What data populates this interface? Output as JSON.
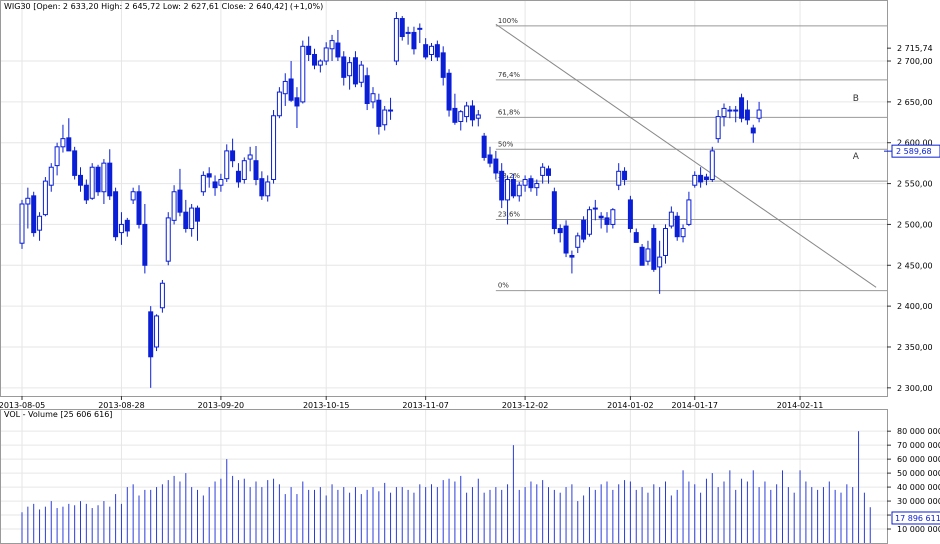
{
  "colors": {
    "accent": "#0a1fd6",
    "volume": "#2a3cd8",
    "grid": "#e6e6e6",
    "axis": "#333333",
    "trendline": "#888888",
    "fib": "#999999"
  },
  "price_legend": {
    "symbol": "WIG30",
    "text": "[Open: 2 633,20  High: 2 645,72  Low: 2 627,61  Close: 2 640,42] (+1,0%)"
  },
  "volume_legend": {
    "title": "VOL - Volume",
    "value": "[25 606 616]"
  },
  "chart_data": [
    {
      "type": "candlestick",
      "name": "WIG30",
      "ylim": [
        2290,
        2760
      ],
      "grid": true,
      "y_ticks": [
        2300,
        2350,
        2400,
        2450,
        2500,
        2550,
        2600,
        2650,
        2700
      ],
      "y_tick_labels": [
        "2 300,00",
        "2 350,00",
        "2 400,00",
        "2 450,00",
        "2 500,00",
        "2 550,00",
        "2 600,00",
        "2 650,00",
        "2 700,00"
      ],
      "x_labels": [
        {
          "i": 0,
          "label": "2013-08-05"
        },
        {
          "i": 17,
          "label": "2013-08-28"
        },
        {
          "i": 34,
          "label": "2013-09-20"
        },
        {
          "i": 52,
          "label": "2013-10-15"
        },
        {
          "i": 69,
          "label": "2013-11-07"
        },
        {
          "i": 86,
          "label": "2013-12-02"
        },
        {
          "i": 104,
          "label": "2014-01-02"
        },
        {
          "i": 115,
          "label": "2014-01-17"
        },
        {
          "i": 133,
          "label": "2014-02-11"
        }
      ],
      "last_value_marker": {
        "value": 2589.68,
        "label": "2 589,68"
      },
      "resistance_marker": {
        "value": 2715.74,
        "label": "2 715,74"
      },
      "fibonacci": {
        "levels": [
          {
            "label": "100%",
            "value": 2743
          },
          {
            "label": "76,4%",
            "value": 2677
          },
          {
            "label": "61,8%",
            "value": 2631
          },
          {
            "label": "50%",
            "value": 2592
          },
          {
            "label": "38,2%",
            "value": 2553
          },
          {
            "label": "23,6%",
            "value": 2506
          },
          {
            "label": "0%",
            "value": 2419
          }
        ],
        "start_i": 81
      },
      "trendline": {
        "from": {
          "i": 81,
          "value": 2745
        },
        "to": {
          "i": 146,
          "value": 2423
        }
      },
      "annotations": [
        {
          "text": "B",
          "i": 142,
          "value": 2655
        },
        {
          "text": "A",
          "i": 142,
          "value": 2584
        }
      ],
      "candles": [
        {
          "o": 2477,
          "h": 2530,
          "l": 2470,
          "c": 2525
        },
        {
          "o": 2525,
          "h": 2545,
          "l": 2495,
          "c": 2532
        },
        {
          "o": 2535,
          "h": 2540,
          "l": 2485,
          "c": 2490
        },
        {
          "o": 2493,
          "h": 2515,
          "l": 2480,
          "c": 2510
        },
        {
          "o": 2512,
          "h": 2558,
          "l": 2510,
          "c": 2553
        },
        {
          "o": 2548,
          "h": 2575,
          "l": 2540,
          "c": 2570
        },
        {
          "o": 2572,
          "h": 2600,
          "l": 2560,
          "c": 2595
        },
        {
          "o": 2595,
          "h": 2622,
          "l": 2588,
          "c": 2605
        },
        {
          "o": 2606,
          "h": 2630,
          "l": 2590,
          "c": 2590
        },
        {
          "o": 2590,
          "h": 2595,
          "l": 2555,
          "c": 2560
        },
        {
          "o": 2560,
          "h": 2570,
          "l": 2540,
          "c": 2548
        },
        {
          "o": 2548,
          "h": 2555,
          "l": 2525,
          "c": 2530
        },
        {
          "o": 2532,
          "h": 2575,
          "l": 2530,
          "c": 2570
        },
        {
          "o": 2570,
          "h": 2573,
          "l": 2535,
          "c": 2540
        },
        {
          "o": 2540,
          "h": 2580,
          "l": 2525,
          "c": 2575
        },
        {
          "o": 2575,
          "h": 2592,
          "l": 2530,
          "c": 2535
        },
        {
          "o": 2540,
          "h": 2545,
          "l": 2480,
          "c": 2485
        },
        {
          "o": 2490,
          "h": 2515,
          "l": 2475,
          "c": 2500
        },
        {
          "o": 2505,
          "h": 2508,
          "l": 2485,
          "c": 2492
        },
        {
          "o": 2530,
          "h": 2545,
          "l": 2525,
          "c": 2540
        },
        {
          "o": 2540,
          "h": 2548,
          "l": 2495,
          "c": 2500
        },
        {
          "o": 2500,
          "h": 2525,
          "l": 2440,
          "c": 2450
        },
        {
          "o": 2393,
          "h": 2400,
          "l": 2300,
          "c": 2338
        },
        {
          "o": 2350,
          "h": 2390,
          "l": 2345,
          "c": 2388
        },
        {
          "o": 2398,
          "h": 2432,
          "l": 2392,
          "c": 2428
        },
        {
          "o": 2455,
          "h": 2515,
          "l": 2450,
          "c": 2508
        },
        {
          "o": 2505,
          "h": 2548,
          "l": 2500,
          "c": 2540
        },
        {
          "o": 2542,
          "h": 2568,
          "l": 2510,
          "c": 2515
        },
        {
          "o": 2515,
          "h": 2530,
          "l": 2490,
          "c": 2495
        },
        {
          "o": 2495,
          "h": 2525,
          "l": 2485,
          "c": 2520
        },
        {
          "o": 2520,
          "h": 2523,
          "l": 2480,
          "c": 2504
        },
        {
          "o": 2540,
          "h": 2565,
          "l": 2535,
          "c": 2560
        },
        {
          "o": 2562,
          "h": 2570,
          "l": 2545,
          "c": 2558
        },
        {
          "o": 2552,
          "h": 2560,
          "l": 2535,
          "c": 2545
        },
        {
          "o": 2548,
          "h": 2562,
          "l": 2540,
          "c": 2555
        },
        {
          "o": 2556,
          "h": 2598,
          "l": 2552,
          "c": 2590
        },
        {
          "o": 2590,
          "h": 2605,
          "l": 2570,
          "c": 2578
        },
        {
          "o": 2565,
          "h": 2575,
          "l": 2545,
          "c": 2552
        },
        {
          "o": 2555,
          "h": 2582,
          "l": 2550,
          "c": 2578
        },
        {
          "o": 2580,
          "h": 2595,
          "l": 2565,
          "c": 2585
        },
        {
          "o": 2578,
          "h": 2596,
          "l": 2548,
          "c": 2555
        },
        {
          "o": 2556,
          "h": 2565,
          "l": 2530,
          "c": 2535
        },
        {
          "o": 2535,
          "h": 2560,
          "l": 2528,
          "c": 2552
        },
        {
          "o": 2555,
          "h": 2640,
          "l": 2550,
          "c": 2633
        },
        {
          "o": 2633,
          "h": 2668,
          "l": 2630,
          "c": 2662
        },
        {
          "o": 2660,
          "h": 2685,
          "l": 2645,
          "c": 2675
        },
        {
          "o": 2678,
          "h": 2700,
          "l": 2650,
          "c": 2652
        },
        {
          "o": 2655,
          "h": 2668,
          "l": 2618,
          "c": 2645
        },
        {
          "o": 2650,
          "h": 2725,
          "l": 2648,
          "c": 2718
        },
        {
          "o": 2718,
          "h": 2730,
          "l": 2700,
          "c": 2708
        },
        {
          "o": 2708,
          "h": 2715,
          "l": 2690,
          "c": 2695
        },
        {
          "o": 2695,
          "h": 2702,
          "l": 2686,
          "c": 2700
        },
        {
          "o": 2700,
          "h": 2723,
          "l": 2695,
          "c": 2716
        },
        {
          "o": 2715,
          "h": 2732,
          "l": 2700,
          "c": 2725
        },
        {
          "o": 2722,
          "h": 2738,
          "l": 2700,
          "c": 2705
        },
        {
          "o": 2705,
          "h": 2712,
          "l": 2670,
          "c": 2680
        },
        {
          "o": 2682,
          "h": 2705,
          "l": 2665,
          "c": 2698
        },
        {
          "o": 2704,
          "h": 2712,
          "l": 2668,
          "c": 2672
        },
        {
          "o": 2674,
          "h": 2700,
          "l": 2668,
          "c": 2695
        },
        {
          "o": 2682,
          "h": 2692,
          "l": 2640,
          "c": 2648
        },
        {
          "o": 2650,
          "h": 2668,
          "l": 2642,
          "c": 2660
        },
        {
          "o": 2652,
          "h": 2660,
          "l": 2610,
          "c": 2620
        },
        {
          "o": 2622,
          "h": 2645,
          "l": 2615,
          "c": 2640
        },
        {
          "o": 2640,
          "h": 2655,
          "l": 2628,
          "c": 2640
        },
        {
          "o": 2700,
          "h": 2760,
          "l": 2695,
          "c": 2752
        },
        {
          "o": 2752,
          "h": 2755,
          "l": 2725,
          "c": 2730
        },
        {
          "o": 2735,
          "h": 2742,
          "l": 2720,
          "c": 2735
        },
        {
          "o": 2735,
          "h": 2742,
          "l": 2708,
          "c": 2715
        },
        {
          "o": 2740,
          "h": 2746,
          "l": 2722,
          "c": 2740
        },
        {
          "o": 2720,
          "h": 2728,
          "l": 2702,
          "c": 2705
        },
        {
          "o": 2708,
          "h": 2722,
          "l": 2700,
          "c": 2718
        },
        {
          "o": 2720,
          "h": 2725,
          "l": 2700,
          "c": 2705
        },
        {
          "o": 2710,
          "h": 2718,
          "l": 2670,
          "c": 2680
        },
        {
          "o": 2685,
          "h": 2690,
          "l": 2632,
          "c": 2640
        },
        {
          "o": 2642,
          "h": 2660,
          "l": 2622,
          "c": 2625
        },
        {
          "o": 2626,
          "h": 2640,
          "l": 2615,
          "c": 2638
        },
        {
          "o": 2632,
          "h": 2650,
          "l": 2625,
          "c": 2645
        },
        {
          "o": 2645,
          "h": 2652,
          "l": 2620,
          "c": 2628
        },
        {
          "o": 2630,
          "h": 2640,
          "l": 2620,
          "c": 2634
        },
        {
          "o": 2608,
          "h": 2612,
          "l": 2578,
          "c": 2582
        },
        {
          "o": 2585,
          "h": 2595,
          "l": 2570,
          "c": 2575
        },
        {
          "o": 2580,
          "h": 2590,
          "l": 2555,
          "c": 2563
        },
        {
          "o": 2565,
          "h": 2575,
          "l": 2520,
          "c": 2530
        },
        {
          "o": 2530,
          "h": 2560,
          "l": 2500,
          "c": 2555
        },
        {
          "o": 2555,
          "h": 2562,
          "l": 2532,
          "c": 2535
        },
        {
          "o": 2535,
          "h": 2552,
          "l": 2528,
          "c": 2548
        },
        {
          "o": 2548,
          "h": 2560,
          "l": 2540,
          "c": 2555
        },
        {
          "o": 2556,
          "h": 2560,
          "l": 2540,
          "c": 2545
        },
        {
          "o": 2545,
          "h": 2555,
          "l": 2535,
          "c": 2550
        },
        {
          "o": 2560,
          "h": 2575,
          "l": 2550,
          "c": 2570
        },
        {
          "o": 2568,
          "h": 2572,
          "l": 2550,
          "c": 2560
        },
        {
          "o": 2540,
          "h": 2545,
          "l": 2488,
          "c": 2495
        },
        {
          "o": 2495,
          "h": 2500,
          "l": 2478,
          "c": 2490
        },
        {
          "o": 2498,
          "h": 2505,
          "l": 2460,
          "c": 2465
        },
        {
          "o": 2462,
          "h": 2468,
          "l": 2440,
          "c": 2460
        },
        {
          "o": 2472,
          "h": 2490,
          "l": 2465,
          "c": 2486
        },
        {
          "o": 2505,
          "h": 2510,
          "l": 2478,
          "c": 2482
        },
        {
          "o": 2488,
          "h": 2522,
          "l": 2485,
          "c": 2518
        },
        {
          "o": 2520,
          "h": 2530,
          "l": 2505,
          "c": 2520
        },
        {
          "o": 2510,
          "h": 2515,
          "l": 2495,
          "c": 2508
        },
        {
          "o": 2508,
          "h": 2515,
          "l": 2490,
          "c": 2500
        },
        {
          "o": 2500,
          "h": 2520,
          "l": 2495,
          "c": 2518
        },
        {
          "o": 2548,
          "h": 2575,
          "l": 2542,
          "c": 2565
        },
        {
          "o": 2565,
          "h": 2570,
          "l": 2548,
          "c": 2555
        },
        {
          "o": 2530,
          "h": 2535,
          "l": 2490,
          "c": 2495
        },
        {
          "o": 2490,
          "h": 2495,
          "l": 2478,
          "c": 2478
        },
        {
          "o": 2472,
          "h": 2476,
          "l": 2450,
          "c": 2450
        },
        {
          "o": 2455,
          "h": 2480,
          "l": 2450,
          "c": 2470
        },
        {
          "o": 2495,
          "h": 2500,
          "l": 2442,
          "c": 2445
        },
        {
          "o": 2448,
          "h": 2480,
          "l": 2415,
          "c": 2460
        },
        {
          "o": 2462,
          "h": 2500,
          "l": 2452,
          "c": 2495
        },
        {
          "o": 2498,
          "h": 2522,
          "l": 2495,
          "c": 2515
        },
        {
          "o": 2510,
          "h": 2515,
          "l": 2480,
          "c": 2485
        },
        {
          "o": 2485,
          "h": 2500,
          "l": 2478,
          "c": 2495
        },
        {
          "o": 2500,
          "h": 2540,
          "l": 2498,
          "c": 2530
        },
        {
          "o": 2548,
          "h": 2565,
          "l": 2545,
          "c": 2560
        },
        {
          "o": 2560,
          "h": 2570,
          "l": 2545,
          "c": 2552
        },
        {
          "o": 2558,
          "h": 2562,
          "l": 2548,
          "c": 2555
        },
        {
          "o": 2555,
          "h": 2595,
          "l": 2552,
          "c": 2590
        },
        {
          "o": 2605,
          "h": 2640,
          "l": 2600,
          "c": 2632
        },
        {
          "o": 2632,
          "h": 2648,
          "l": 2620,
          "c": 2642
        },
        {
          "o": 2640,
          "h": 2645,
          "l": 2630,
          "c": 2640
        },
        {
          "o": 2640,
          "h": 2645,
          "l": 2625,
          "c": 2640
        },
        {
          "o": 2655,
          "h": 2660,
          "l": 2625,
          "c": 2630
        },
        {
          "o": 2640,
          "h": 2652,
          "l": 2622,
          "c": 2628
        },
        {
          "o": 2618,
          "h": 2622,
          "l": 2600,
          "c": 2612
        },
        {
          "o": 2630,
          "h": 2650,
          "l": 2625,
          "c": 2640
        }
      ]
    },
    {
      "type": "bar",
      "name": "VOL - Volume",
      "ylim": [
        0,
        88000000
      ],
      "y_ticks": [
        10000000,
        20000000,
        30000000,
        40000000,
        50000000,
        60000000,
        70000000,
        80000000
      ],
      "y_tick_labels": [
        "10 000 000",
        "20 000 000",
        "30 000 000",
        "40 000 000",
        "50 000 000",
        "60 000 000",
        "70 000 000",
        "80 000 000"
      ],
      "last_value_marker": {
        "value": 17896611,
        "label": "17 896 611"
      },
      "values": [
        22000000,
        26000000,
        28000000,
        24000000,
        26000000,
        30000000,
        25000000,
        26000000,
        28000000,
        27000000,
        30000000,
        28000000,
        25000000,
        27000000,
        30000000,
        26000000,
        35000000,
        28000000,
        40000000,
        42000000,
        34000000,
        38000000,
        38000000,
        40000000,
        42000000,
        45000000,
        48000000,
        44000000,
        50000000,
        40000000,
        38000000,
        34000000,
        40000000,
        44000000,
        46000000,
        60000000,
        48000000,
        45000000,
        46000000,
        40000000,
        44000000,
        40000000,
        45000000,
        46000000,
        42000000,
        35000000,
        40000000,
        35000000,
        44000000,
        38000000,
        38000000,
        40000000,
        34000000,
        42000000,
        38000000,
        40000000,
        36000000,
        40000000,
        35000000,
        38000000,
        40000000,
        37000000,
        43000000,
        36000000,
        40000000,
        40000000,
        38000000,
        36000000,
        42000000,
        40000000,
        42000000,
        40000000,
        45000000,
        46000000,
        44000000,
        48000000,
        36000000,
        40000000,
        46000000,
        36000000,
        38000000,
        40000000,
        38000000,
        42000000,
        70000000,
        38000000,
        40000000,
        44000000,
        42000000,
        45000000,
        40000000,
        38000000,
        36000000,
        40000000,
        42000000,
        30000000,
        34000000,
        40000000,
        38000000,
        42000000,
        44000000,
        38000000,
        42000000,
        45000000,
        44000000,
        38000000,
        40000000,
        36000000,
        42000000,
        40000000,
        44000000,
        34000000,
        38000000,
        52000000,
        44000000,
        42000000,
        36000000,
        46000000,
        50000000,
        40000000,
        44000000,
        52000000,
        38000000,
        46000000,
        44000000,
        52000000,
        40000000,
        44000000,
        38000000,
        42000000,
        52000000,
        40000000,
        36000000,
        52000000,
        44000000,
        40000000,
        38000000,
        40000000,
        44000000,
        38000000,
        36000000,
        42000000,
        40000000,
        80000000,
        36000000,
        25606616
      ],
      "visible_count": 146,
      "x_labels": []
    }
  ]
}
